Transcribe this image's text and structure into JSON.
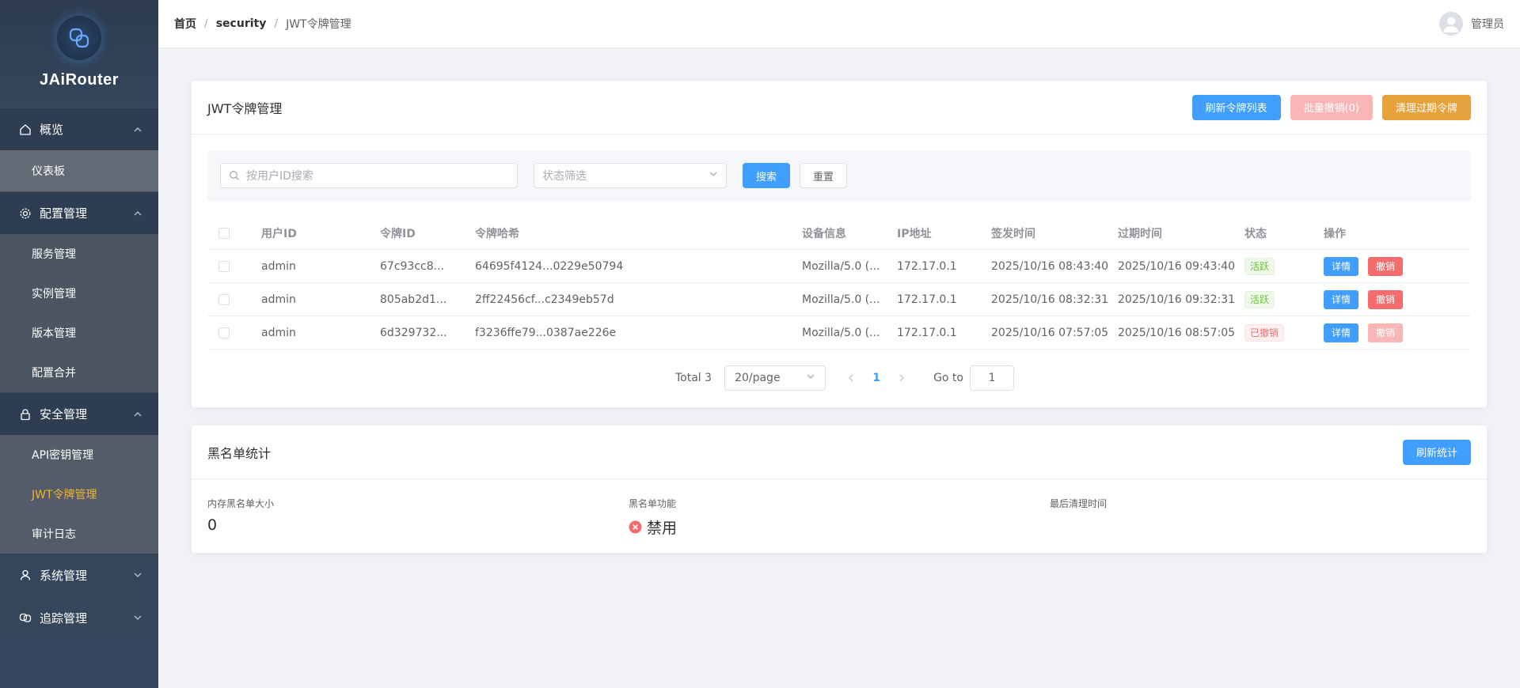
{
  "app": {
    "name": "JAiRouter"
  },
  "sidebar": {
    "groups": [
      {
        "label": "概览",
        "items": [
          {
            "label": "仪表板"
          }
        ]
      },
      {
        "label": "配置管理",
        "items": [
          {
            "label": "服务管理"
          },
          {
            "label": "实例管理"
          },
          {
            "label": "版本管理"
          },
          {
            "label": "配置合并"
          }
        ]
      },
      {
        "label": "安全管理",
        "items": [
          {
            "label": "API密钥管理"
          },
          {
            "label": "JWT令牌管理"
          },
          {
            "label": "审计日志"
          }
        ]
      },
      {
        "label": "系统管理"
      },
      {
        "label": "追踪管理"
      }
    ],
    "active_item": "JWT令牌管理"
  },
  "header": {
    "breadcrumb": [
      "首页",
      "security",
      "JWT令牌管理"
    ],
    "user": "管理员"
  },
  "token_card": {
    "title": "JWT令牌管理",
    "buttons": {
      "refresh": "刷新令牌列表",
      "batch_revoke": "批量撤销(0)",
      "clean_expired": "清理过期令牌"
    },
    "filters": {
      "search_placeholder": "按用户ID搜索",
      "status_placeholder": "状态筛选",
      "search_button": "搜索",
      "reset_button": "重置"
    },
    "columns": [
      "用户ID",
      "令牌ID",
      "令牌哈希",
      "设备信息",
      "IP地址",
      "签发时间",
      "过期时间",
      "状态",
      "操作"
    ],
    "rows": [
      {
        "user_id": "admin",
        "token_id": "67c93cc8...",
        "token_hash": "64695f4124...0229e50794",
        "device": "Mozilla/5.0 (...",
        "ip": "172.17.0.1",
        "issued": "2025/10/16 08:43:40",
        "expires": "2025/10/16 09:43:40",
        "status": "活跃",
        "status_type": "success",
        "detail": "详情",
        "revoke": "撤销",
        "revoke_enabled": true
      },
      {
        "user_id": "admin",
        "token_id": "805ab2d1...",
        "token_hash": "2ff22456cf...c2349eb57d",
        "device": "Mozilla/5.0 (...",
        "ip": "172.17.0.1",
        "issued": "2025/10/16 08:32:31",
        "expires": "2025/10/16 09:32:31",
        "status": "活跃",
        "status_type": "success",
        "detail": "详情",
        "revoke": "撤销",
        "revoke_enabled": true
      },
      {
        "user_id": "admin",
        "token_id": "6d329732...",
        "token_hash": "f3236ffe79...0387ae226e",
        "device": "Mozilla/5.0 (...",
        "ip": "172.17.0.1",
        "issued": "2025/10/16 07:57:05",
        "expires": "2025/10/16 08:57:05",
        "status": "已撤销",
        "status_type": "danger",
        "detail": "详情",
        "revoke": "撤销",
        "revoke_enabled": false
      }
    ],
    "pagination": {
      "total": "Total 3",
      "page_size": "20/page",
      "current": "1",
      "goto_label": "Go to",
      "goto_value": "1"
    }
  },
  "blacklist_card": {
    "title": "黑名单统计",
    "refresh_button": "刷新统计",
    "stats": [
      {
        "label": "内存黑名单大小",
        "value": "0"
      },
      {
        "label": "黑名单功能",
        "value": "禁用"
      },
      {
        "label": "最后清理时间",
        "value": ""
      }
    ]
  },
  "colors": {
    "primary": "#409eff",
    "warning": "#e6a23c",
    "danger": "#f56c6c",
    "success": "#67c23a",
    "active_menu": "#f0b434"
  },
  "icons": [
    "logo-icon",
    "home-icon",
    "gear-icon",
    "lock-icon",
    "user-icon",
    "link-icon",
    "search-icon",
    "chevron-down-icon",
    "chevron-up-icon",
    "chevron-left-icon",
    "chevron-right-icon",
    "avatar-icon",
    "x-circle-icon"
  ]
}
